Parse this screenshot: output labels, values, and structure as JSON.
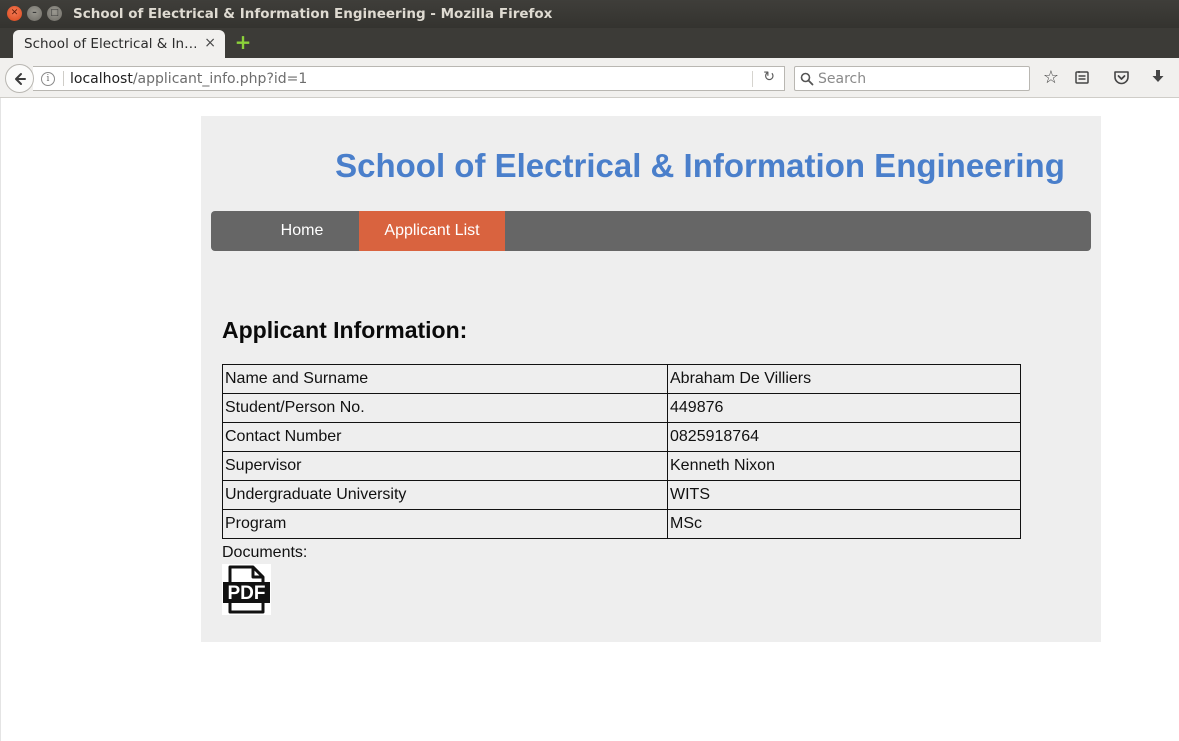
{
  "window": {
    "title": "School of Electrical & Information Engineering - Mozilla Firefox"
  },
  "tab": {
    "label": "School of Electrical & In…",
    "close_glyph": "×"
  },
  "navbar": {
    "url_host": "localhost",
    "url_path": "/applicant_info.php?id=1",
    "search_placeholder": "Search"
  },
  "page": {
    "site_title": "School of Electrical & Information Engineering",
    "menu": {
      "home": "Home",
      "applicant_list": "Applicant List",
      "active_color": "#d9633f"
    },
    "heading": "Applicant Information:",
    "rows": [
      {
        "field": "Name and Surname",
        "value": "Abraham De Villiers"
      },
      {
        "field": "Student/Person No.",
        "value": "449876"
      },
      {
        "field": "Contact Number",
        "value": "0825918764"
      },
      {
        "field": "Supervisor",
        "value": "Kenneth Nixon"
      },
      {
        "field": "Undergraduate University",
        "value": "WITS"
      },
      {
        "field": "Program",
        "value": "MSc"
      }
    ],
    "documents_label": "Documents:",
    "pdf_icon_text": "PDF"
  },
  "colors": {
    "title_blue": "#4a7fcb",
    "menu_bg": "#666666",
    "panel_bg": "#eeeeee"
  }
}
